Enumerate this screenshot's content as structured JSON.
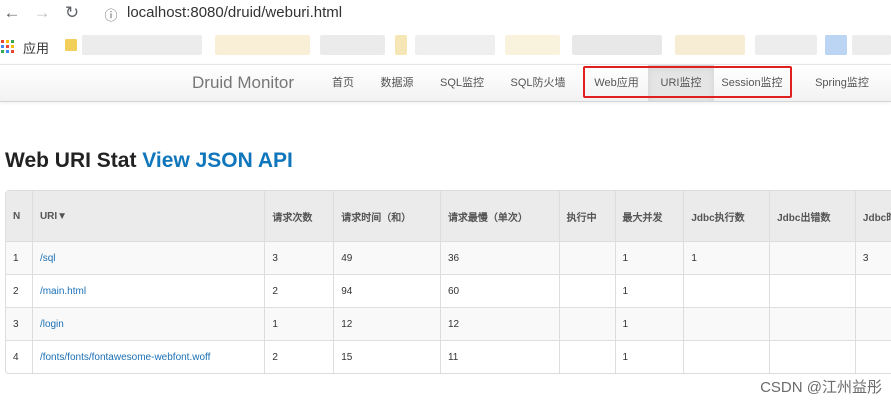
{
  "browser": {
    "url": "localhost:8080/druid/weburi.html",
    "apps_label": "应用"
  },
  "navbar": {
    "brand": "Druid Monitor",
    "items": [
      {
        "label": "首页"
      },
      {
        "label": "数据源"
      },
      {
        "label": "SQL监控"
      },
      {
        "label": "SQL防火墙"
      },
      {
        "label": "Web应用"
      },
      {
        "label": "URI监控",
        "active": true
      },
      {
        "label": "Session监控"
      },
      {
        "label": "Spring监控"
      }
    ],
    "highlight_color": "#e0201e"
  },
  "page": {
    "title_text": "Web URI Stat ",
    "title_link": "View JSON API"
  },
  "table": {
    "columns": [
      "N",
      "URI▼",
      "请求次数",
      "请求时间（和）",
      "请求最慢（单次）",
      "执行中",
      "最大并发",
      "Jdbc执行数",
      "Jdbc出错数",
      "Jdbc时"
    ],
    "rows": [
      [
        "1",
        "/sql",
        "3",
        "49",
        "36",
        "",
        "1",
        "1",
        "",
        "3"
      ],
      [
        "2",
        "/main.html",
        "2",
        "94",
        "60",
        "",
        "1",
        "",
        "",
        ""
      ],
      [
        "3",
        "/login",
        "1",
        "12",
        "12",
        "",
        "1",
        "",
        "",
        ""
      ],
      [
        "4",
        "/fonts/fonts/fontawesome-webfont.woff",
        "2",
        "15",
        "11",
        "",
        "1",
        "",
        "",
        ""
      ]
    ]
  },
  "watermark": "CSDN @江州益彤",
  "colors": {
    "link": "#0f76bc",
    "uri_link": "#1b70b5"
  }
}
